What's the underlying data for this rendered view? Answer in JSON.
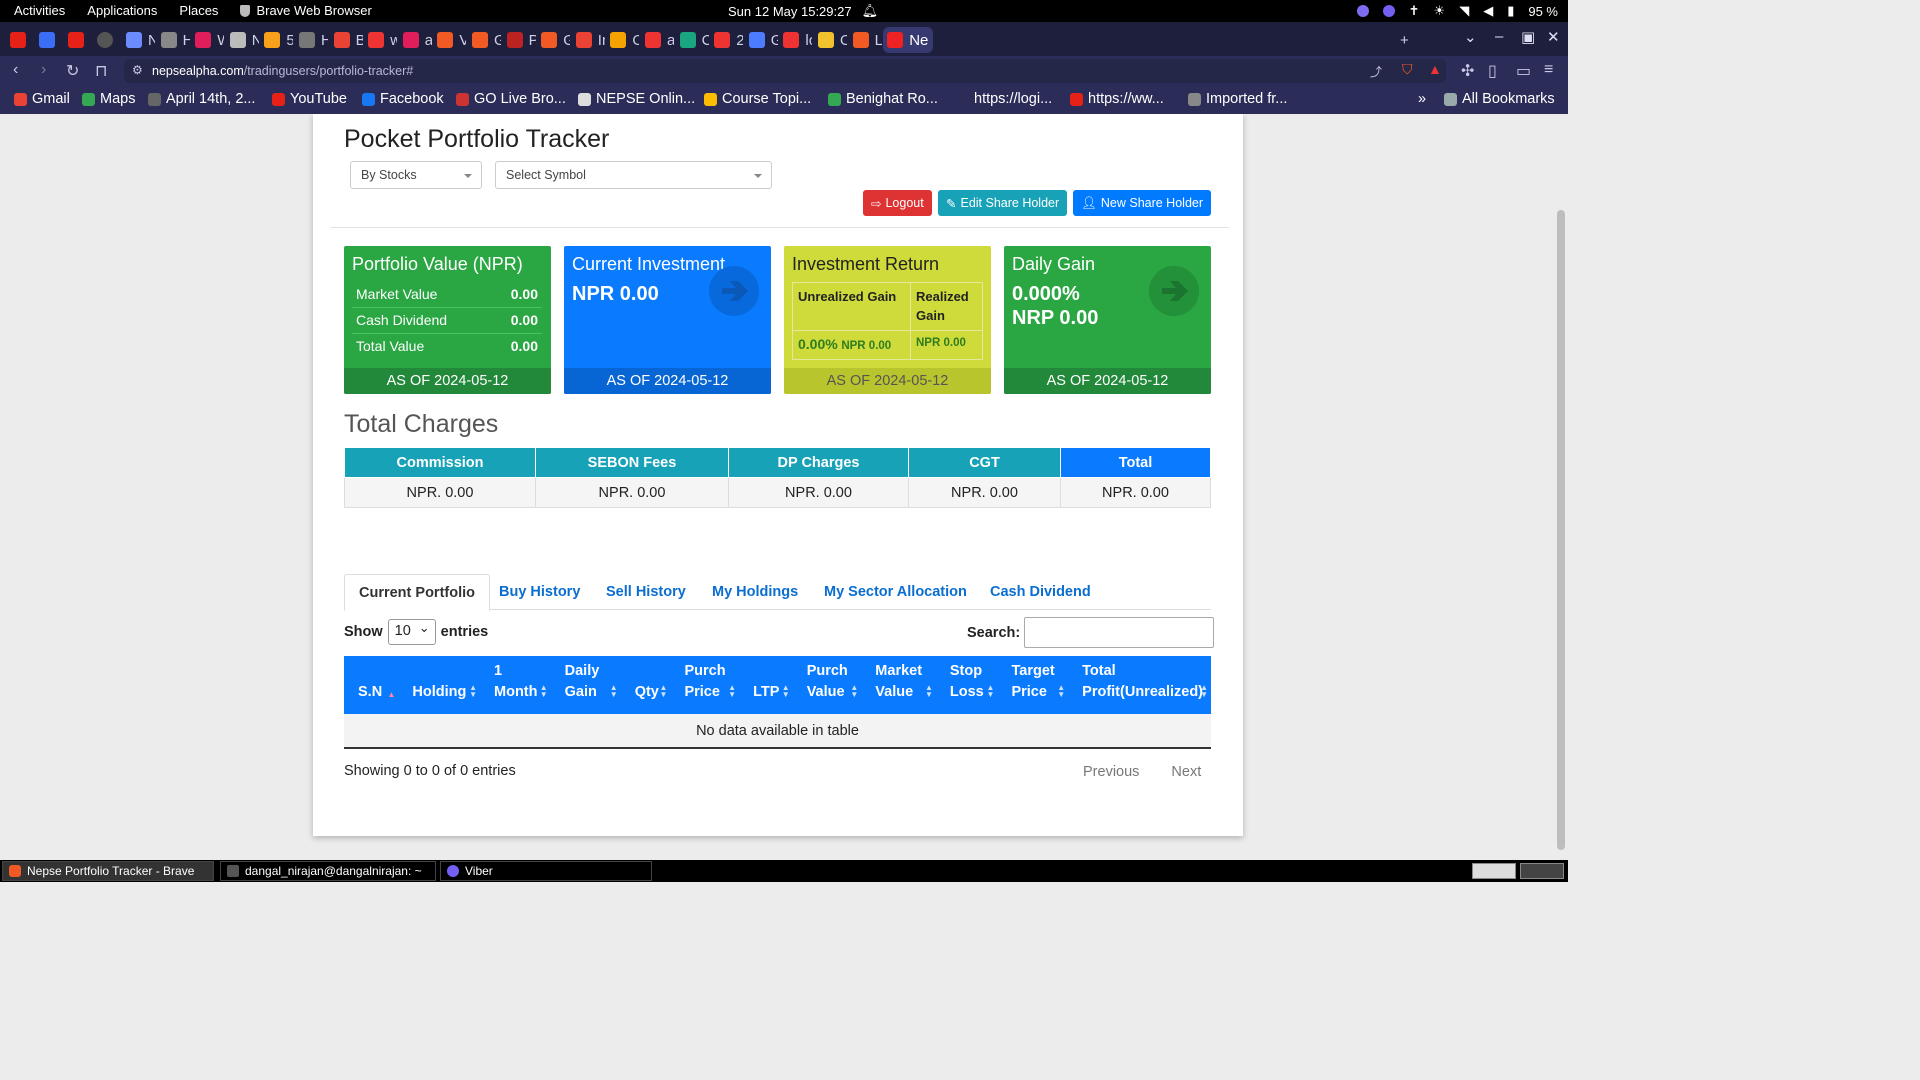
{
  "system": {
    "activities": "Activities",
    "applications": "Applications",
    "places": "Places",
    "app_name": "Brave Web Browser",
    "clock": "Sun 12 May  15:29:27",
    "battery": "95 %"
  },
  "browser": {
    "tabs": [
      "Ne",
      "Ho",
      "WI",
      "NE",
      "50",
      "Ho",
      "Bu",
      "we",
      "ale",
      "Vie",
      "GS",
      "Po",
      "Gr",
      "Inl",
      "Ov",
      "au",
      "Ch",
      "24",
      "Ge",
      "lo",
      "Of",
      "Lo",
      "Ne"
    ],
    "url_domain": "nepsealpha.com",
    "url_path": "/tradingusers/portfolio-tracker#",
    "new_tab": "+",
    "bookmarks": [
      "Gmail",
      "Maps",
      "April 14th, 2...",
      "YouTube",
      "Facebook",
      "GO Live Bro...",
      "NEPSE Onlin...",
      "Course Topi...",
      "Benighat Ro...",
      "https://logi...",
      "https://ww...",
      "Imported fr..."
    ],
    "bookmarks_more": "»",
    "all_bookmarks": "All Bookmarks"
  },
  "page": {
    "title": "Pocket Portfolio Tracker",
    "filter_select": "By Stocks",
    "symbol_select": "Select Symbol",
    "buttons": {
      "logout": "Logout",
      "edit": "Edit Share Holder",
      "new": "New Share Holder"
    },
    "portfolio_value": {
      "title": "Portfolio Value (NPR)",
      "rows": [
        {
          "label": "Market Value",
          "value": "0.00"
        },
        {
          "label": "Cash Dividend",
          "value": "0.00"
        },
        {
          "label": "Total Value",
          "value": "0.00"
        }
      ],
      "as_of": "AS OF 2024-05-12"
    },
    "current_investment": {
      "title": "Current Investment",
      "value": "NPR 0.00",
      "as_of": "AS OF 2024-05-12"
    },
    "investment_return": {
      "title": "Investment Return",
      "unrealized_label": "Unrealized Gain",
      "realized_label": "Realized Gain",
      "unrealized_pct": "0.00%",
      "unrealized_npr": "NPR 0.00",
      "realized_npr": "NPR 0.00",
      "as_of": "AS OF 2024-05-12"
    },
    "daily_gain": {
      "title": "Daily Gain",
      "pct": "0.000%",
      "value": "NRP 0.00",
      "as_of": "AS OF 2024-05-12"
    },
    "charges": {
      "title": "Total Charges",
      "headers": [
        "Commission",
        "SEBON Fees",
        "DP Charges",
        "CGT",
        "Total"
      ],
      "values": [
        "NPR. 0.00",
        "NPR. 0.00",
        "NPR. 0.00",
        "NPR. 0.00",
        "NPR. 0.00"
      ]
    },
    "tabs": [
      "Current Portfolio",
      "Buy History",
      "Sell History",
      "My Holdings",
      "My Sector Allocation",
      "Cash Dividend"
    ],
    "show_label": "Show",
    "entries_value": "10",
    "entries_label": "entries",
    "search_label": "Search:",
    "table_headers": [
      "S.N",
      "Holding",
      "1 Month",
      "Daily Gain",
      "Qty",
      "Purch Price",
      "LTP",
      "Purch Value",
      "Market Value",
      "Stop Loss",
      "Target Price",
      "Total Profit(Unrealized)"
    ],
    "empty_message": "No data available in table",
    "info": "Showing 0 to 0 of 0 entries",
    "prev": "Previous",
    "next": "Next"
  },
  "taskbar": {
    "items": [
      "Nepse Portfolio Tracker - Brave",
      "dangal_nirajan@dangalnirajan: ~",
      "Viber"
    ]
  },
  "colors": {
    "green": "#2aa643",
    "blue": "#0a7bff",
    "yellow": "#cfdb3a",
    "teal": "#17a2b8",
    "red": "#dd3333"
  }
}
